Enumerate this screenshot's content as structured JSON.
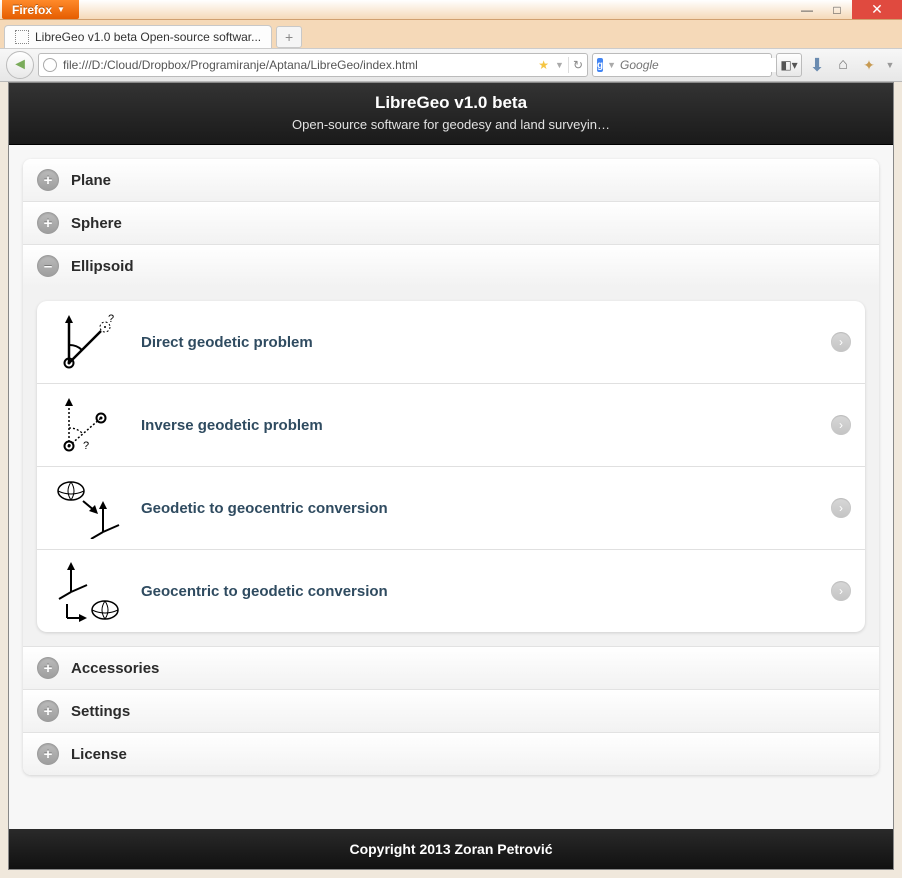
{
  "window": {
    "firefox_label": "Firefox",
    "minimize": "—",
    "maximize": "□",
    "close": "✕"
  },
  "tab": {
    "title": "LibreGeo v1.0 beta Open-source softwar...",
    "new_tab": "+"
  },
  "nav": {
    "url": "file:///D:/Cloud/Dropbox/Programiranje/Aptana/LibreGeo/index.html",
    "search_placeholder": "Google"
  },
  "app": {
    "title": "LibreGeo v1.0 beta",
    "subtitle": "Open-source software for geodesy and land surveyin…",
    "footer": "Copyright 2013 Zoran Petrović"
  },
  "sections": {
    "plane": "Plane",
    "sphere": "Sphere",
    "ellipsoid": "Ellipsoid",
    "accessories": "Accessories",
    "settings": "Settings",
    "license": "License"
  },
  "ellipsoid_items": [
    {
      "label": "Direct geodetic problem"
    },
    {
      "label": "Inverse geodetic problem"
    },
    {
      "label": "Geodetic to geocentric conversion"
    },
    {
      "label": "Geocentric to geodetic conversion"
    }
  ]
}
